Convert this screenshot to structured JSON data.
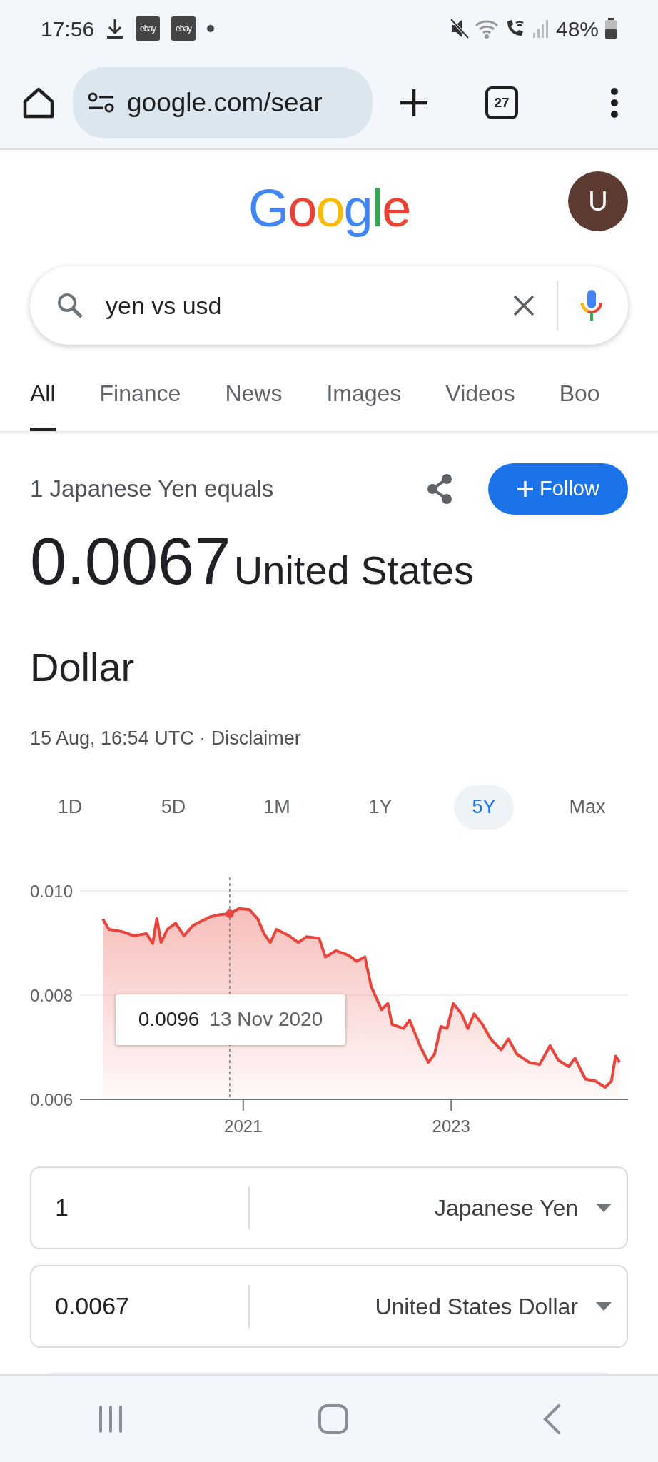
{
  "status_bar": {
    "time": "17:56",
    "notifications": [
      {
        "kind": "download"
      },
      {
        "kind": "app",
        "label": "ebay"
      },
      {
        "kind": "app",
        "label": "ebay"
      },
      {
        "kind": "dot"
      }
    ],
    "battery": "48%"
  },
  "browser": {
    "url": "google.com/sear",
    "tab_count": "27"
  },
  "header": {
    "logo": "Google",
    "avatar": "U"
  },
  "search": {
    "query": "yen vs usd"
  },
  "tabs": [
    {
      "label": "All",
      "selected": true
    },
    {
      "label": "Finance",
      "selected": false
    },
    {
      "label": "News",
      "selected": false
    },
    {
      "label": "Images",
      "selected": false
    },
    {
      "label": "Videos",
      "selected": false
    },
    {
      "label": "Boo",
      "selected": false
    }
  ],
  "result": {
    "caption": "1 Japanese Yen equals",
    "follow_button": "Follow",
    "amount": "0.0067",
    "currency": "United States Dollar",
    "timestamp": "15 Aug, 16:54 UTC ·",
    "disclaimer": "Disclaimer"
  },
  "ranges": [
    {
      "label": "1D",
      "selected": false
    },
    {
      "label": "5D",
      "selected": false
    },
    {
      "label": "1M",
      "selected": false
    },
    {
      "label": "1Y",
      "selected": false
    },
    {
      "label": "5Y",
      "selected": true
    },
    {
      "label": "Max",
      "selected": false
    }
  ],
  "chart_data": {
    "type": "area",
    "xlim": [
      2019.43,
      2024.7
    ],
    "ylim": [
      0.006,
      0.01
    ],
    "xticks": [
      {
        "value": 2021,
        "label": "2021"
      },
      {
        "value": 2023,
        "label": "2023"
      }
    ],
    "yticks": [
      {
        "value": 0.006,
        "label": "0.006"
      },
      {
        "value": 0.008,
        "label": "0.008"
      },
      {
        "value": 0.01,
        "label": "0.010"
      }
    ],
    "x": [
      2019.65,
      2019.71,
      2019.83,
      2019.95,
      2020.07,
      2020.13,
      2020.17,
      2020.21,
      2020.27,
      2020.35,
      2020.43,
      2020.52,
      2020.6,
      2020.68,
      2020.76,
      2020.87,
      2020.96,
      2021.06,
      2021.14,
      2021.2,
      2021.26,
      2021.32,
      2021.44,
      2021.53,
      2021.61,
      2021.73,
      2021.79,
      2021.89,
      2022.01,
      2022.09,
      2022.17,
      2022.23,
      2022.33,
      2022.39,
      2022.43,
      2022.54,
      2022.6,
      2022.7,
      2022.78,
      2022.84,
      2022.9,
      2022.96,
      2023.02,
      2023.1,
      2023.16,
      2023.22,
      2023.3,
      2023.38,
      2023.48,
      2023.55,
      2023.63,
      2023.75,
      2023.85,
      2023.95,
      2024.03,
      2024.13,
      2024.19,
      2024.29,
      2024.39,
      2024.48,
      2024.54,
      2024.58,
      2024.62
    ],
    "series": [
      {
        "color": "#e8453c",
        "values": [
          0.00946,
          0.00926,
          0.00922,
          0.00914,
          0.00918,
          0.00899,
          0.00947,
          0.00901,
          0.00926,
          0.00938,
          0.00914,
          0.00934,
          0.00942,
          0.0095,
          0.00954,
          0.00956,
          0.00966,
          0.00964,
          0.00946,
          0.00918,
          0.00901,
          0.00926,
          0.00914,
          0.00901,
          0.00912,
          0.00909,
          0.00873,
          0.00885,
          0.00877,
          0.00865,
          0.00873,
          0.00817,
          0.00772,
          0.00784,
          0.00744,
          0.00736,
          0.00752,
          0.00703,
          0.00671,
          0.00687,
          0.0074,
          0.00736,
          0.00784,
          0.00764,
          0.00736,
          0.00764,
          0.00744,
          0.00716,
          0.00695,
          0.00716,
          0.00687,
          0.00671,
          0.00667,
          0.00703,
          0.00675,
          0.00663,
          0.00679,
          0.00639,
          0.00635,
          0.00623,
          0.00635,
          0.00683,
          0.00671
        ]
      }
    ],
    "ref_lines": [
      {
        "axis": "x",
        "value": 2020.87
      }
    ]
  },
  "tooltip": {
    "value": "0.0096",
    "date": "13 Nov 2020"
  },
  "converter": [
    {
      "amount": "1",
      "currency": "Japanese Yen"
    },
    {
      "amount": "0.0067",
      "currency": "United States Dollar"
    }
  ]
}
